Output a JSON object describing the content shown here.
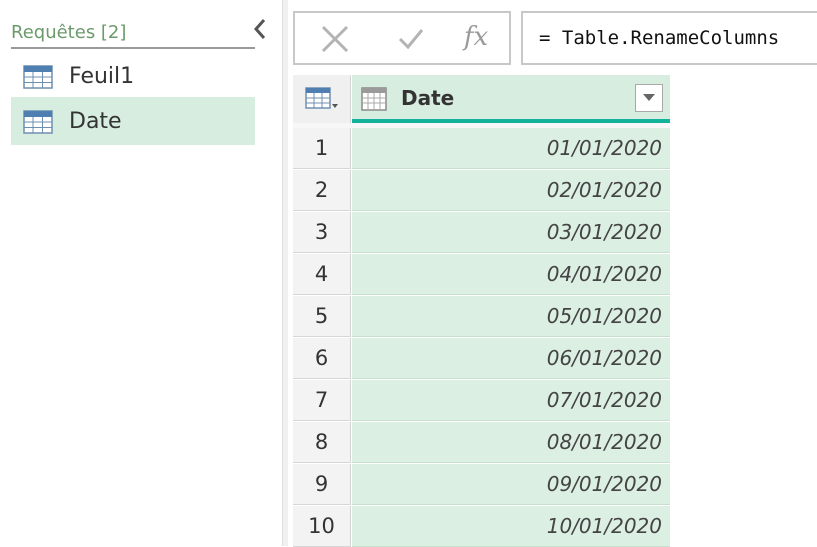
{
  "queries_pane": {
    "title": "Requêtes [2]",
    "items": [
      {
        "label": "Feuil1",
        "selected": false,
        "icon": "table-icon"
      },
      {
        "label": "Date",
        "selected": true,
        "icon": "table-icon"
      }
    ],
    "collapse_icon": "chevron-left-icon"
  },
  "formula_bar": {
    "cancel_icon": "close-icon",
    "commit_icon": "checkmark-icon",
    "fx_label": "fx",
    "formula": "= Table.RenameColumns"
  },
  "grid": {
    "column": {
      "label": "Date",
      "type_icon": "date-type-icon",
      "filter_icon": "chevron-down-icon"
    },
    "rows": [
      {
        "num": "1",
        "value": "01/01/2020"
      },
      {
        "num": "2",
        "value": "02/01/2020"
      },
      {
        "num": "3",
        "value": "03/01/2020"
      },
      {
        "num": "4",
        "value": "04/01/2020"
      },
      {
        "num": "5",
        "value": "05/01/2020"
      },
      {
        "num": "6",
        "value": "06/01/2020"
      },
      {
        "num": "7",
        "value": "07/01/2020"
      },
      {
        "num": "8",
        "value": "08/01/2020"
      },
      {
        "num": "9",
        "value": "09/01/2020"
      },
      {
        "num": "10",
        "value": "10/01/2020"
      }
    ]
  },
  "colors": {
    "selected_bg": "#d7ede0",
    "quality_bar": "#12b39a",
    "title_green": "#6b9a6b"
  }
}
